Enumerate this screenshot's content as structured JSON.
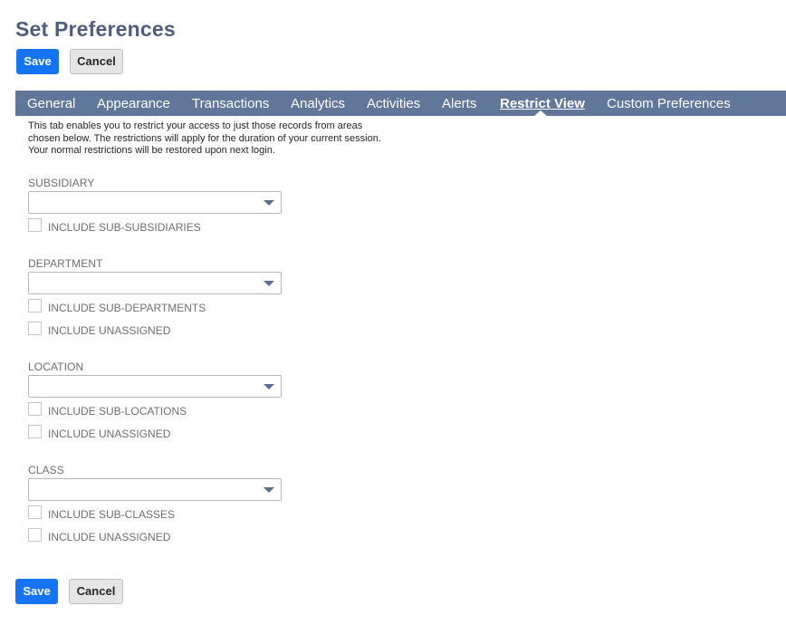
{
  "page": {
    "title": "Set Preferences"
  },
  "buttons": {
    "save": "Save",
    "cancel": "Cancel"
  },
  "tabs": [
    {
      "label": "General",
      "active": false
    },
    {
      "label": "Appearance",
      "active": false
    },
    {
      "label": "Transactions",
      "active": false
    },
    {
      "label": "Analytics",
      "active": false
    },
    {
      "label": "Activities",
      "active": false
    },
    {
      "label": "Alerts",
      "active": false
    },
    {
      "label": "Restrict View",
      "active": true
    },
    {
      "label": "Custom Preferences",
      "active": false
    }
  ],
  "description": {
    "line1": "This tab enables you to restrict your access to just those records from areas",
    "line2": "chosen below. The restrictions will apply for the duration of your current session.",
    "line3": "Your normal restrictions will be restored upon next login."
  },
  "sections": {
    "subsidiary": {
      "label": "SUBSIDIARY",
      "value": "",
      "checkboxes": [
        {
          "label": "INCLUDE SUB-SUBSIDIARIES",
          "checked": false
        }
      ]
    },
    "department": {
      "label": "DEPARTMENT",
      "value": "",
      "checkboxes": [
        {
          "label": "INCLUDE SUB-DEPARTMENTS",
          "checked": false
        },
        {
          "label": "INCLUDE UNASSIGNED",
          "checked": false
        }
      ]
    },
    "location": {
      "label": "LOCATION",
      "value": "",
      "checkboxes": [
        {
          "label": "INCLUDE SUB-LOCATIONS",
          "checked": false
        },
        {
          "label": "INCLUDE UNASSIGNED",
          "checked": false
        }
      ]
    },
    "class": {
      "label": "CLASS",
      "value": "",
      "checkboxes": [
        {
          "label": "INCLUDE SUB-CLASSES",
          "checked": false
        },
        {
          "label": "INCLUDE UNASSIGNED",
          "checked": false
        }
      ]
    }
  },
  "colors": {
    "primary_button": "#1474f5",
    "tab_bar": "#607799",
    "title": "#4d5f7c"
  },
  "icons": {
    "select_arrow": "caret-down-icon",
    "active_tab_marker": "caret-up-icon"
  }
}
